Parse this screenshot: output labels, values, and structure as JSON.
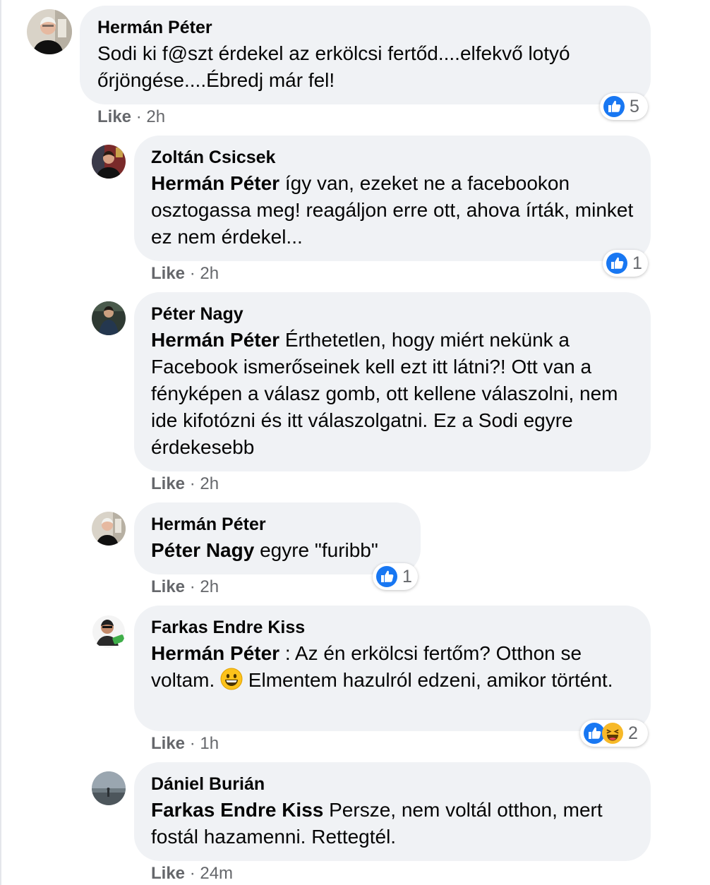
{
  "comments": [
    {
      "author": "Hermán Péter",
      "text": "Sodi ki f@szt érdekel az erkölcsi fertőd....elfekvő lotyó őrjöngése....Ébredj már fel!",
      "like_label": "Like",
      "time": "2h",
      "reaction_count": "5"
    },
    {
      "author": "Zoltán Csicsek",
      "mention": "Hermán Péter",
      "text": " így van, ezeket ne a facebookon osztogassa meg! reagáljon erre ott, ahova írták, minket ez nem érdekel...",
      "like_label": "Like",
      "time": "2h",
      "reaction_count": "1"
    },
    {
      "author": "Péter Nagy",
      "mention": "Hermán Péter",
      "text": " Érthetetlen, hogy miért nekünk a Facebook ismerőseinek kell ezt itt látni?! Ott van a fényképen a válasz gomb, ott kellene válaszolni, nem ide kifotózni és itt válaszolgatni. Ez a Sodi egyre érdekesebb",
      "like_label": "Like",
      "time": "2h"
    },
    {
      "author": "Hermán Péter",
      "mention": "Péter Nagy",
      "text": " egyre \"furibb\"",
      "like_label": "Like",
      "time": "2h",
      "reaction_count": "1"
    },
    {
      "author": "Farkas Endre Kiss",
      "mention": "Hermán Péter",
      "text_part1": " : Az én erkölcsi fertőm? Otthon se voltam. ",
      "emoji": "grinning-face-emoji",
      "text_part2": " Elmentem hazulról edzeni, amikor történt.",
      "like_label": "Like",
      "time": "1h",
      "reaction_count": "2"
    },
    {
      "author": "Dániel Burián",
      "mention": "Farkas Endre Kiss",
      "text": " Persze, nem voltál otthon, mert fostál hazamenni. Rettegtél.",
      "like_label": "Like",
      "time": "24m"
    }
  ],
  "separator": " · ",
  "icons": {
    "like": "like-thumb-icon",
    "haha": "haha-laughing-icon"
  },
  "colors": {
    "bubble": "#f0f2f5",
    "like_blue": "#1877f2",
    "meta_gray": "#65676b",
    "haha_yellow": "#f7b928"
  }
}
